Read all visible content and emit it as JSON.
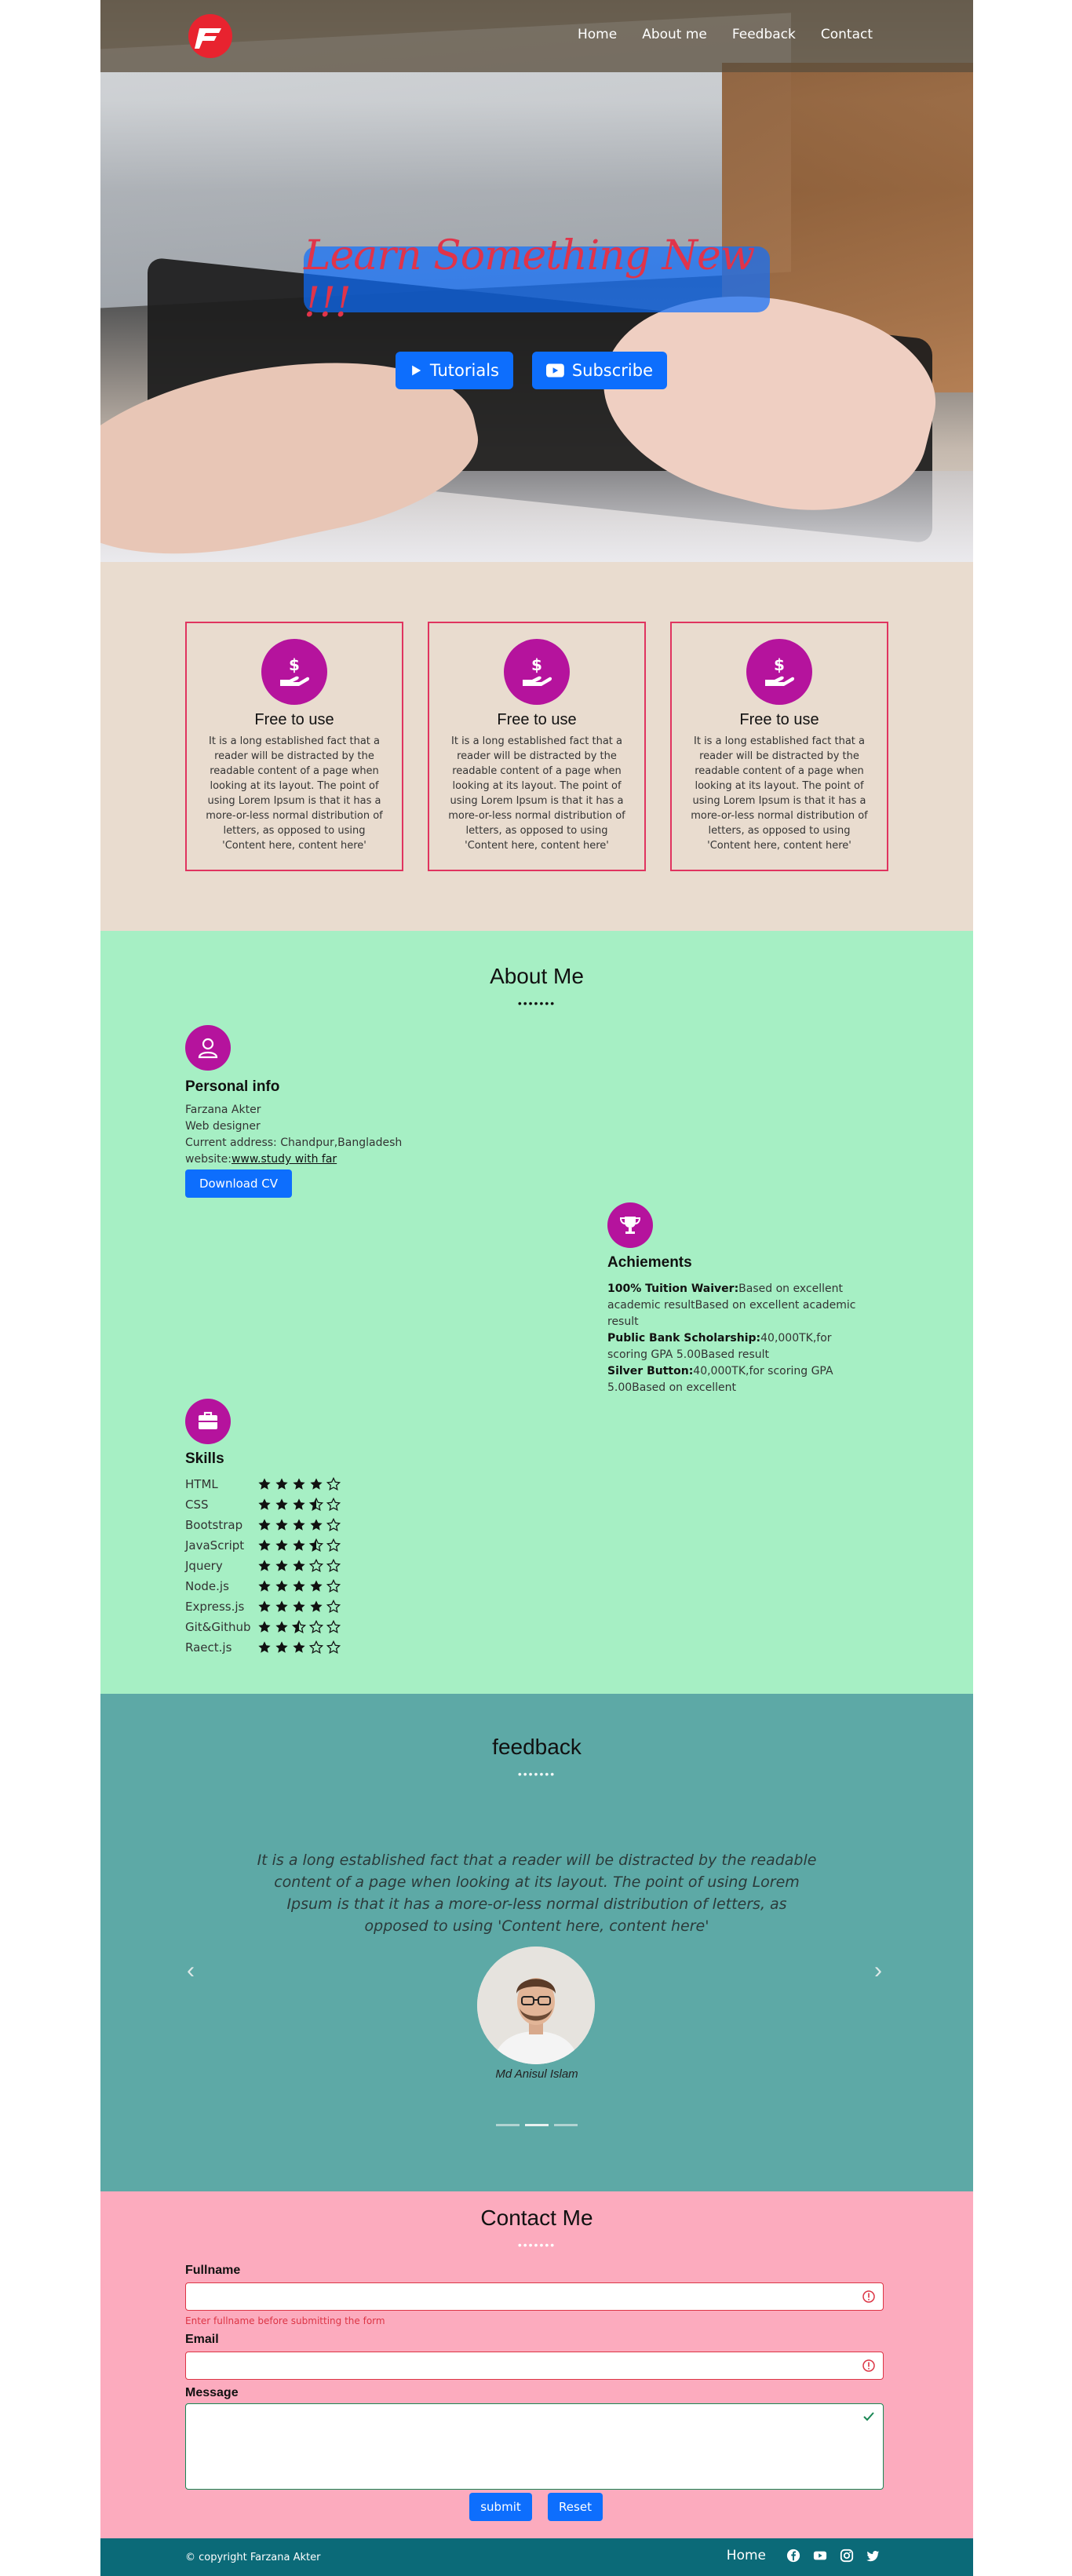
{
  "nav": {
    "items": [
      "Home",
      "About me",
      "Feedback",
      "Contact"
    ]
  },
  "hero": {
    "headline": "Learn Something New !!!",
    "tutorials": "Tutorials",
    "subscribe": "Subscribe"
  },
  "features": {
    "cards": [
      {
        "title": "Free to use",
        "text": "It is a long established fact that a reader will be distracted by the readable content of a page when looking at its layout. The point of using Lorem Ipsum is that it has a more-or-less normal distribution of letters, as opposed to using 'Content here, content here'"
      },
      {
        "title": "Free to use",
        "text": "It is a long established fact that a reader will be distracted by the readable content of a page when looking at its layout. The point of using Lorem Ipsum is that it has a more-or-less normal distribution of letters, as opposed to using 'Content here, content here'"
      },
      {
        "title": "Free to use",
        "text": "It is a long established fact that a reader will be distracted by the readable content of a page when looking at its layout. The point of using Lorem Ipsum is that it has a more-or-less normal distribution of letters, as opposed to using 'Content here, content here'"
      }
    ]
  },
  "about": {
    "title": "About Me",
    "dots": "•••••••",
    "personal": {
      "title": "Personal info",
      "name": "Farzana Akter",
      "role": "Web designer",
      "address": "Current address: Chandpur,Bangladesh",
      "website_label": "website:",
      "website_link": "www.study with far",
      "download": "Download CV"
    },
    "achievements": {
      "title": "Achiements",
      "items": [
        {
          "bold": "100% Tuition Waiver:",
          "text": "Based on excellent academic resultBased on excellent academic result"
        },
        {
          "bold": "Public Bank Scholarship:",
          "text": "40,000TK,for scoring GPA 5.00Based result"
        },
        {
          "bold": "Silver Button:",
          "text": "40,000TK,for scoring GPA 5.00Based on excellent"
        }
      ]
    },
    "skills": {
      "title": "Skills",
      "items": [
        {
          "name": "HTML",
          "rating": 4
        },
        {
          "name": "CSS",
          "rating": 3.5
        },
        {
          "name": "Bootstrap",
          "rating": 4
        },
        {
          "name": "JavaScript",
          "rating": 3.5
        },
        {
          "name": "Jquery",
          "rating": 3
        },
        {
          "name": "Node.js",
          "rating": 4
        },
        {
          "name": "Express.js",
          "rating": 4
        },
        {
          "name": "Git&Github",
          "rating": 2.5
        },
        {
          "name": "Raect.js",
          "rating": 3
        }
      ]
    }
  },
  "feedback": {
    "title": "feedback",
    "dots": "•••••••",
    "quote": "It is a long established fact that a reader will be distracted by the readable content of a page when looking at its layout. The point of using Lorem Ipsum is that it has a more-or-less normal distribution of letters, as opposed to using 'Content here, content here'",
    "person": "Md Anisul Islam",
    "prev": "‹",
    "next": "›"
  },
  "contact": {
    "title": "Contact Me",
    "dots": "•••••••",
    "fullname_label": "Fullname",
    "fullname_help": "Enter fullname before submitting the form",
    "email_label": "Email",
    "message_label": "Message",
    "submit": "submit",
    "reset": "Reset"
  },
  "footer": {
    "copyright": "© copyright Farzana Akter",
    "home": "Home"
  },
  "colors": {
    "accent": "#0d6efd",
    "icon_bg": "#b5139d",
    "about_bg": "#a6efc4",
    "feedback_bg": "#5da9a6",
    "contact_bg": "#fcabbe",
    "footer_bg": "#0b6a78",
    "features_bg": "#e9dccf"
  }
}
